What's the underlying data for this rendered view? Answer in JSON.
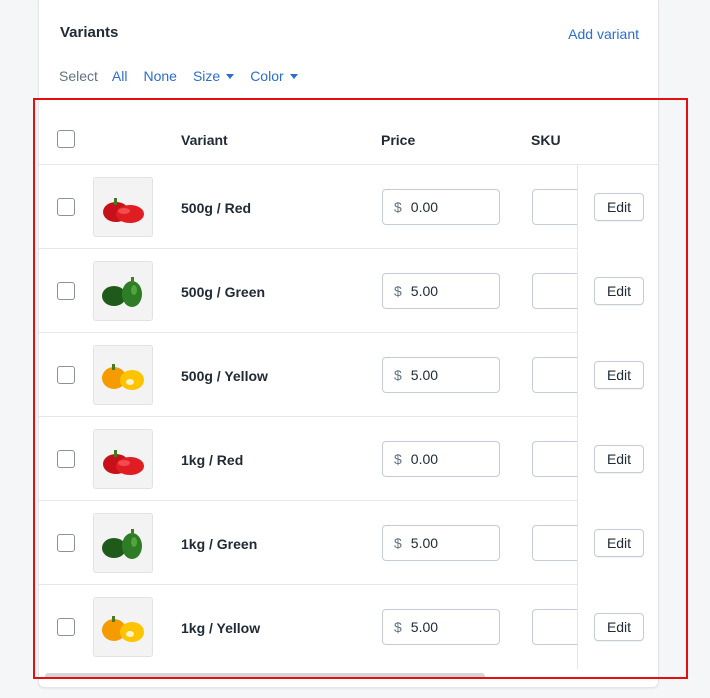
{
  "card": {
    "title": "Variants",
    "add_variant_label": "Add variant"
  },
  "select_bar": {
    "label": "Select",
    "all": "All",
    "none": "None",
    "size": "Size",
    "color": "Color"
  },
  "table": {
    "columns": [
      "Variant",
      "Price",
      "SKU"
    ],
    "rows": [
      {
        "name": "500g / Red",
        "currency": "$",
        "price": "0.00",
        "sku": "",
        "image": "red-pepper",
        "edit": "Edit"
      },
      {
        "name": "500g / Green",
        "currency": "$",
        "price": "5.00",
        "sku": "",
        "image": "green-pepper",
        "edit": "Edit"
      },
      {
        "name": "500g / Yellow",
        "currency": "$",
        "price": "5.00",
        "sku": "",
        "image": "yellow-pepper",
        "edit": "Edit"
      },
      {
        "name": "1kg / Red",
        "currency": "$",
        "price": "0.00",
        "sku": "",
        "image": "red-pepper",
        "edit": "Edit"
      },
      {
        "name": "1kg / Green",
        "currency": "$",
        "price": "5.00",
        "sku": "",
        "image": "green-pepper",
        "edit": "Edit"
      },
      {
        "name": "1kg / Yellow",
        "currency": "$",
        "price": "5.00",
        "sku": "",
        "image": "yellow-pepper",
        "edit": "Edit"
      }
    ]
  },
  "colors": {
    "link": "#2c6ecb",
    "highlight": "#e3100e",
    "text": "#212b36",
    "muted": "#637381"
  }
}
